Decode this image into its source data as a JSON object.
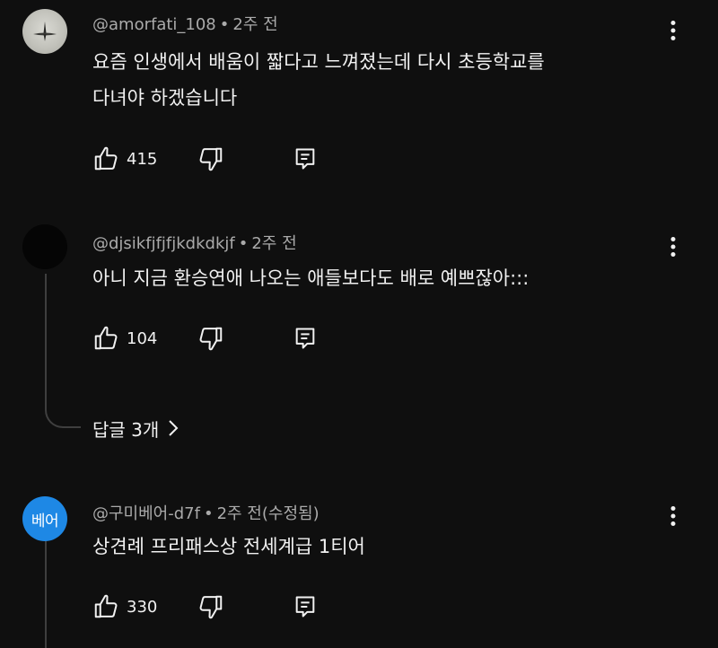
{
  "comments": [
    {
      "author": "@amorfati_108",
      "time": "2주 전",
      "lines": [
        "요즘 인생에서 배움이 짧다고 느껴졌는데 다시 초등학교를",
        "다녀야 하겠습니다"
      ],
      "likes": "415"
    },
    {
      "author": "@djsikfjfjfjkdkdkjf",
      "time": "2주 전",
      "lines": [
        "아니 지금 환승연애 나오는 애들보다도 배로 예쁘잖아:::"
      ],
      "likes": "104",
      "replies_label": "답글 3개"
    },
    {
      "author": "@구미베어-d7f",
      "time": "2주 전(수정됨)",
      "avatar_text": "베어",
      "avatar_color": "#1e88e5",
      "lines": [
        "상견례 프리패스상 전세계급 1티어"
      ],
      "likes": "330"
    }
  ],
  "separator": "•",
  "icons": {
    "like": "thumbs-up-icon",
    "dislike": "thumbs-down-icon",
    "reply": "reply-comment-icon",
    "more": "more-vert-icon",
    "chevron": "chevron-right-icon"
  },
  "colors": {
    "background": "#0f0f0f",
    "text": "#f1f1f1",
    "meta": "#aaaaaa",
    "thread_line": "#3f3f3f"
  }
}
